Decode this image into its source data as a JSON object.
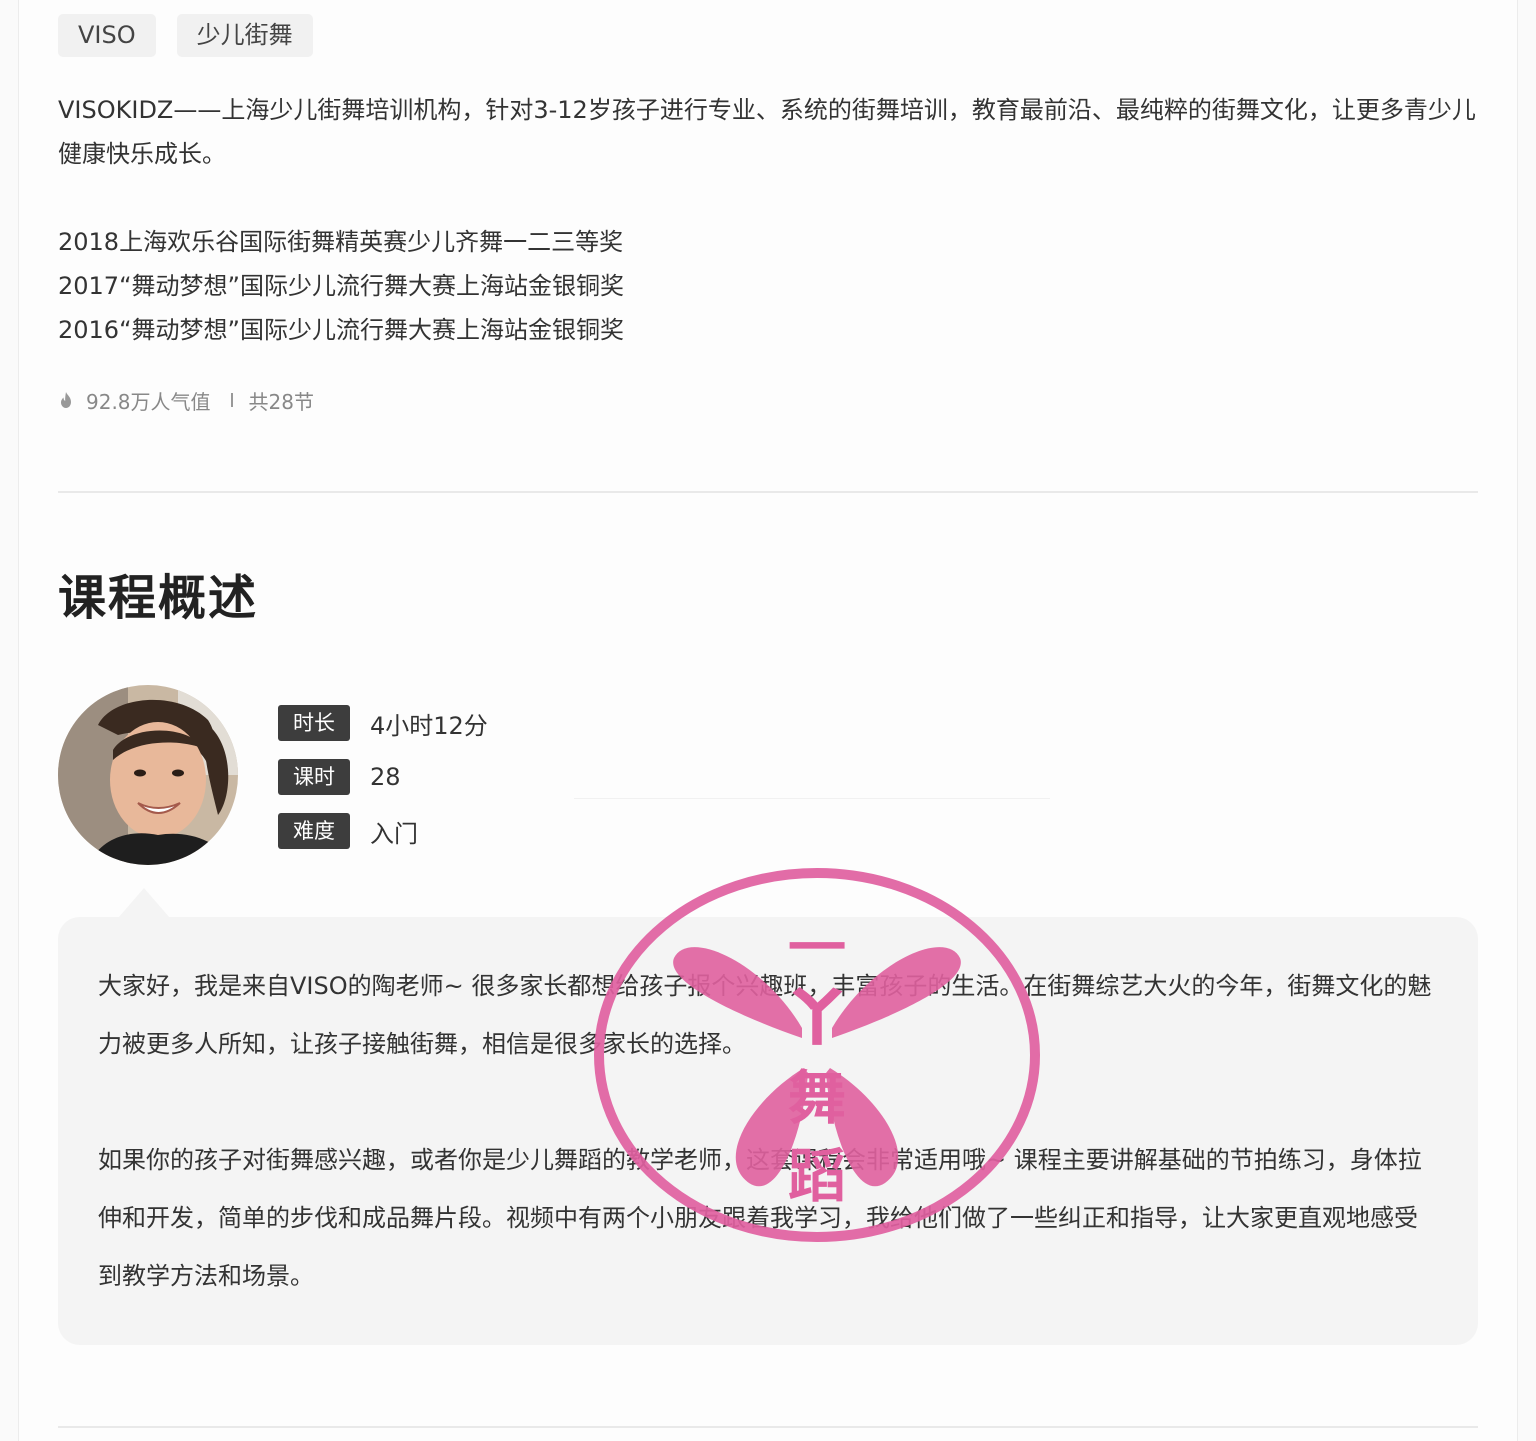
{
  "tags": [
    "VISO",
    "少儿街舞"
  ],
  "intro": "VISOKIDZ——上海少儿街舞培训机构，针对3-12岁孩子进行专业、系统的街舞培训，教育最前沿、最纯粹的街舞文化，让更多青少儿健康快乐成长。",
  "awards": [
    "2018上海欢乐谷国际街舞精英赛少儿齐舞一二三等奖",
    "2017“舞动梦想”国际少儿流行舞大赛上海站金银铜奖",
    "2016“舞动梦想”国际少儿流行舞大赛上海站金银铜奖"
  ],
  "stats": {
    "popularity": "92.8万人气值",
    "lessons": "共28节",
    "icon": "fire-icon"
  },
  "section_title": "课程概述",
  "meta": [
    {
      "label": "时长",
      "value": "4小时12分"
    },
    {
      "label": "课时",
      "value": "28"
    },
    {
      "label": "难度",
      "value": "入门"
    }
  ],
  "description": [
    "大家好，我是来自VISO的陶老师~ 很多家长都想给孩子报个兴趣班，丰富孩子的生活。在街舞综艺大火的今年，街舞文化的魅力被更多人所知，让孩子接触街舞，相信是很多家长的选择。",
    "如果你的孩子对街舞感兴趣，或者你是少儿舞蹈的教学老师，这套课程会非常适用哦~ 课程主要讲解基础的节拍练习，身体拉伸和开发，简单的步伐和成品舞片段。视频中有两个小朋友跟着我学习，我给他们做了一些纠正和指导，让大家更直观地感受到教学方法和场景。"
  ],
  "watermark": {
    "chars": [
      "一",
      "丫",
      "舞",
      "蹈"
    ],
    "color": "#e0609f"
  }
}
